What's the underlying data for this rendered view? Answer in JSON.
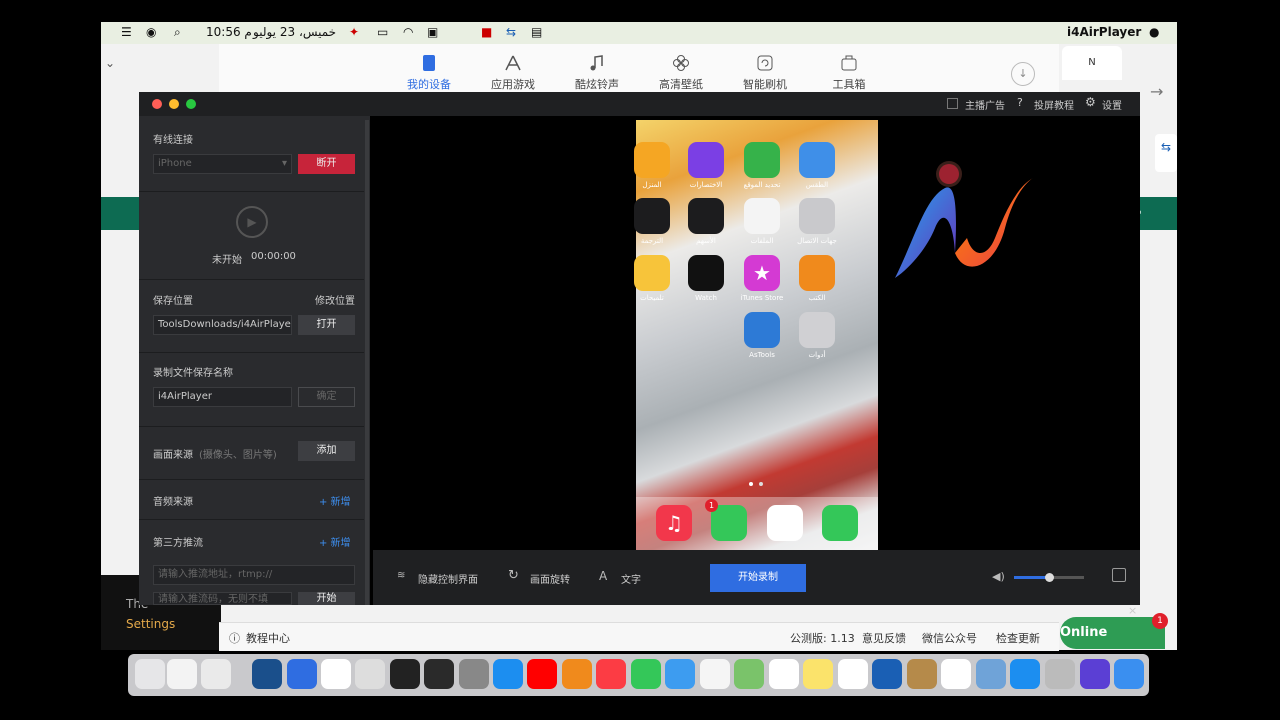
{
  "menubar": {
    "app_name": "i4AirPlayer",
    "clock": "10:56 م",
    "date": "خميس، 23 يوليو"
  },
  "bg_toolbar": {
    "tabs": [
      "我的设备",
      "应用游戏",
      "酷炫铃声",
      "高清壁纸",
      "智能刷机",
      "工具箱"
    ]
  },
  "bg_status": {
    "tutorial": "教程中心",
    "version": "公测版: 1.13",
    "feedback": "意见反馈",
    "wechat": "微信公众号",
    "update": "检查更新"
  },
  "bg_left": {
    "line1": "The",
    "settings": "Settings"
  },
  "online_badge": {
    "label": "Online",
    "count": "1"
  },
  "titlebar": {
    "anchor_ad": "主播广告",
    "cast_tutorial": "投屏教程",
    "settings": "设置"
  },
  "sidebar": {
    "wired_title": "有线连接",
    "device_value": "iPhone",
    "disconnect": "断开",
    "status": "未开始",
    "timer": "00:00:00",
    "save_location": "保存位置",
    "modify_location": "修改位置",
    "path_value": "ToolsDownloads/i4AirPlayer",
    "open": "打开",
    "record_name_title": "录制文件保存名称",
    "record_name_value": "i4AirPlayer",
    "confirm": "确定",
    "source_title": "画面来源",
    "source_hint": "(摄像头、图片等)",
    "add": "添加",
    "audio_title": "音频来源",
    "audio_add": "+ 新增",
    "third_title": "第三方推流",
    "third_add": "+ 新增",
    "rtmp_placeholder": "请输入推流地址，rtmp://",
    "key_placeholder": "请输入推流码，无则不填",
    "start": "开始"
  },
  "controls": {
    "hide_panel": "隐藏控制界面",
    "rotate": "画面旋转",
    "text": "文字",
    "start_record": "开始录制",
    "volume_fraction": 0.5
  },
  "phone": {
    "apps": [
      {
        "label": "المنزل",
        "icon": "home-icon",
        "color": "#f5a623"
      },
      {
        "label": "الاختصارات",
        "icon": "shortcuts-icon",
        "color": "#7b3fe4"
      },
      {
        "label": "تحديد الموقع",
        "icon": "find-my-icon",
        "color": "#36b24a"
      },
      {
        "label": "الطقس",
        "icon": "weather-icon",
        "color": "#3f8fe8"
      },
      {
        "label": "الترجمة",
        "icon": "translate-icon",
        "color": "#1c1c1e"
      },
      {
        "label": "الأسهم",
        "icon": "stocks-icon",
        "color": "#1c1c1e"
      },
      {
        "label": "الملفات",
        "icon": "files-icon",
        "color": "#2f88f0"
      },
      {
        "label": "جهات الاتصال",
        "icon": "contacts-icon",
        "color": "#c9c9cc"
      },
      {
        "label": "تلميحات",
        "icon": "tips-icon",
        "color": "#f7c43a"
      },
      {
        "label": "Watch",
        "icon": "watch-icon",
        "color": "#111111"
      },
      {
        "label": "iTunes Store",
        "icon": "itunes-icon",
        "color": "#d43ad3"
      },
      {
        "label": "الكتب",
        "icon": "books-icon",
        "color": "#f08a1c"
      },
      {
        "label": "AsTools",
        "icon": "astools-icon",
        "color": "#2d7ad6"
      },
      {
        "label": "أدوات",
        "icon": "utilities-folder-icon",
        "color": "#d0d0d3"
      }
    ],
    "dock_apps": [
      "music-icon",
      "messages-icon",
      "safari-icon",
      "phone-icon"
    ],
    "messages_badge": "1"
  },
  "colors": {
    "accent_red": "#c7243a",
    "accent_blue": "#2f6de1",
    "sidebar_bg": "#2a2b2e",
    "green_bar": "#0d6b52"
  }
}
